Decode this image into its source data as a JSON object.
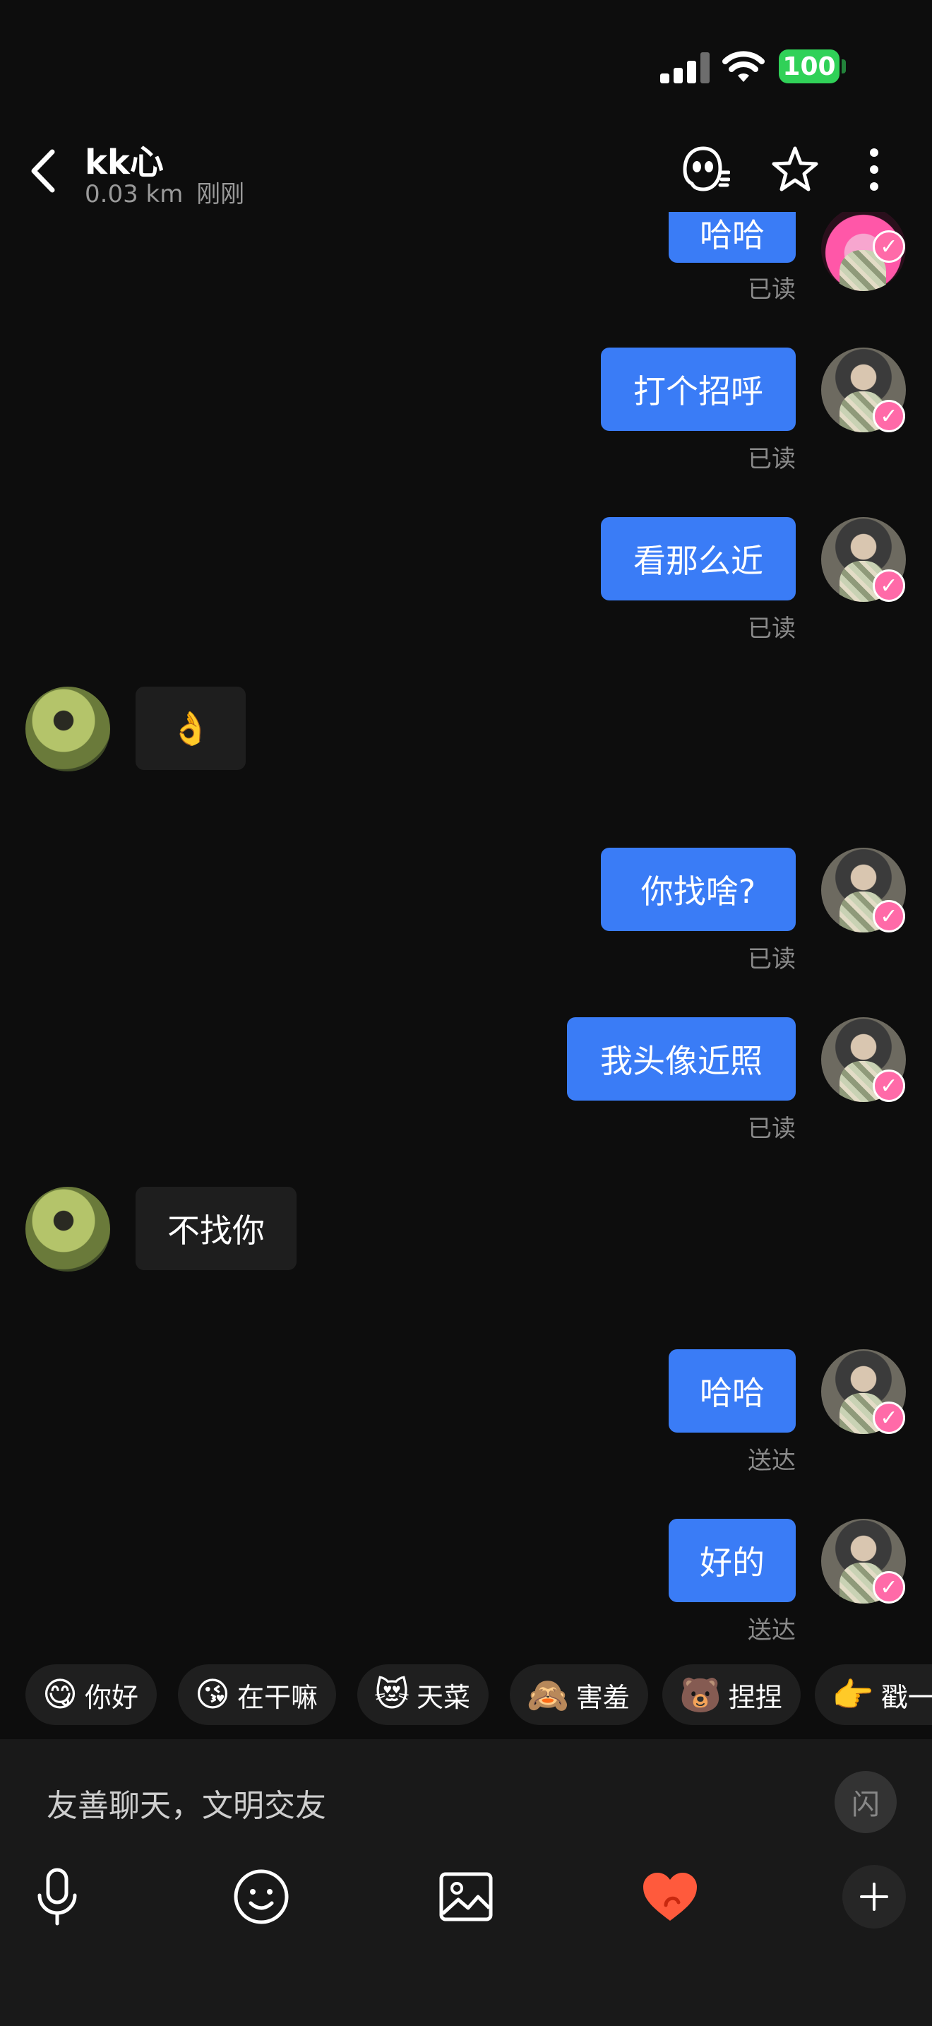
{
  "status_bar": {
    "battery": "100"
  },
  "header": {
    "title": "kk心",
    "distance": "0.03 km",
    "last_seen": "刚刚"
  },
  "messages": [
    {
      "side": "out",
      "text": "哈哈",
      "status": "已读"
    },
    {
      "side": "out",
      "text": "打个招呼",
      "status": "已读"
    },
    {
      "side": "out",
      "text": "看那么近",
      "status": "已读"
    },
    {
      "side": "in",
      "text": "👌"
    },
    {
      "side": "out",
      "text": "你找啥?",
      "status": "已读"
    },
    {
      "side": "out",
      "text": "我头像近照",
      "status": "已读"
    },
    {
      "side": "in",
      "text": "不找你"
    },
    {
      "side": "out",
      "text": "哈哈",
      "status": "送达"
    },
    {
      "side": "out",
      "text": "好的",
      "status": "送达"
    }
  ],
  "quick_replies": [
    {
      "emoji": "😋",
      "label": "你好"
    },
    {
      "emoji": "😘",
      "label": "在干嘛"
    },
    {
      "emoji": "😻",
      "label": "天菜"
    },
    {
      "emoji": "🙈",
      "label": "害羞"
    },
    {
      "emoji": "🐻",
      "label": "捏捏"
    },
    {
      "emoji": "👉",
      "label": "戳一"
    }
  ],
  "input": {
    "placeholder": "友善聊天，文明交友",
    "flash_label": "闪"
  },
  "colors": {
    "outgoing": "#3a7cf6",
    "incoming": "#1e1e1e",
    "background": "#0d0d0d",
    "battery": "#30d158",
    "accent_heart": "#ff5a3c"
  }
}
